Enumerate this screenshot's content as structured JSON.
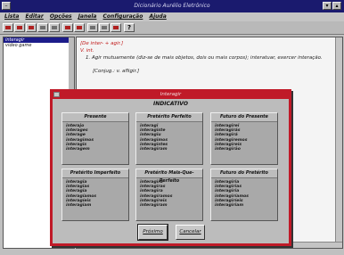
{
  "app": {
    "title": "Dicionário Aurélio Eletrônico",
    "menu": [
      "Lista",
      "Editar",
      "Opções",
      "Janela",
      "Configuração",
      "Ajuda"
    ]
  },
  "word_list": {
    "items": [
      "interagir",
      "video game"
    ]
  },
  "entry": {
    "headword_line": "[De inter- + agir.]",
    "pos": "V. int.",
    "definition": "1. Agir mutuamente (diz-se de mais objetos, dois ou mais corpos); interatuar, exercer interação.",
    "conj_note": "[Conjug.: v. afligir.]"
  },
  "dialog": {
    "title": "Interagir",
    "mode": "INDICATIVO",
    "tenses": [
      {
        "name": "Presente",
        "forms": [
          "interajo",
          "interages",
          "interage",
          "interagimos",
          "interagis",
          "interagem"
        ]
      },
      {
        "name": "Pretérito Perfeito",
        "forms": [
          "interagi",
          "interagiste",
          "interagiu",
          "interagimos",
          "interagistes",
          "interagiram"
        ]
      },
      {
        "name": "Futuro do Presente",
        "forms": [
          "interagirei",
          "interagirás",
          "interagirá",
          "interagiremos",
          "interagireis",
          "interagirão"
        ]
      },
      {
        "name": "Pretérito Imperfeito",
        "forms": [
          "interagia",
          "interagias",
          "interagia",
          "interagíamos",
          "interagíeis",
          "interagiam"
        ]
      },
      {
        "name": "Pretérito Mais-Que-Perfeito",
        "forms": [
          "interagira",
          "interagiras",
          "interagira",
          "interagíramos",
          "interagíreis",
          "interagiram"
        ]
      },
      {
        "name": "Futuro do Pretérito",
        "forms": [
          "interagiria",
          "interagirias",
          "interagiria",
          "interagiríamos",
          "interagiríeis",
          "interagiriam"
        ]
      }
    ],
    "next_label": "Próximo",
    "cancel_label": "Cancelar"
  },
  "colors": {
    "titlebar": "#1a1a6e",
    "dialog_frame": "#c01a28",
    "accent_text": "#c01818"
  }
}
